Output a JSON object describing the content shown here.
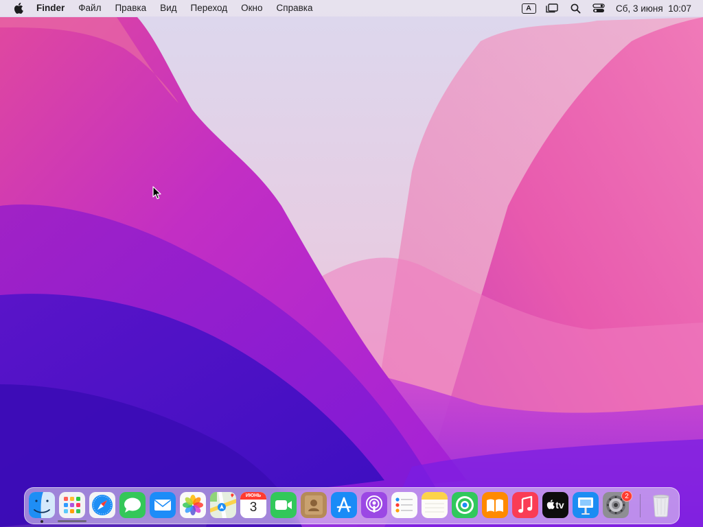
{
  "menubar": {
    "app_name": "Finder",
    "menus": [
      "Файл",
      "Правка",
      "Вид",
      "Переход",
      "Окно",
      "Справка"
    ],
    "input_source": "A",
    "date": "Сб, 3 июня",
    "time": "10:07",
    "icons": [
      "apple-icon",
      "input-source-icon",
      "stage-manager-icon",
      "spotlight-icon",
      "control-center-icon"
    ]
  },
  "dock": {
    "apps": [
      {
        "name": "finder",
        "icon": "finder-icon",
        "running": true
      },
      {
        "name": "launchpad",
        "icon": "launchpad-icon"
      },
      {
        "name": "safari",
        "icon": "safari-icon"
      },
      {
        "name": "messages",
        "icon": "messages-icon"
      },
      {
        "name": "mail",
        "icon": "mail-icon"
      },
      {
        "name": "photos",
        "icon": "photos-icon"
      },
      {
        "name": "maps",
        "icon": "maps-icon"
      },
      {
        "name": "calendar",
        "icon": "calendar-icon"
      },
      {
        "name": "facetime",
        "icon": "facetime-icon"
      },
      {
        "name": "contacts",
        "icon": "contacts-icon"
      },
      {
        "name": "app-store",
        "icon": "app-store-icon"
      },
      {
        "name": "podcasts",
        "icon": "podcasts-icon"
      },
      {
        "name": "reminders",
        "icon": "reminders-icon"
      },
      {
        "name": "notes",
        "icon": "notes-icon"
      },
      {
        "name": "find-my",
        "icon": "find-my-icon"
      },
      {
        "name": "books",
        "icon": "books-icon"
      },
      {
        "name": "music",
        "icon": "music-icon"
      },
      {
        "name": "apple-tv",
        "icon": "apple-tv-icon"
      },
      {
        "name": "keynote",
        "icon": "keynote-icon"
      },
      {
        "name": "system-settings",
        "icon": "gear-icon"
      },
      {
        "name": "trash",
        "icon": "trash-icon"
      }
    ],
    "calendar": {
      "month": "ИЮНЬ",
      "day": "3"
    },
    "settings_badge": "2",
    "tv_label": "tv"
  },
  "colors": {
    "accent_red": "#ff3b30",
    "wallpaper_deep_purple": "#4a10c8",
    "wallpaper_magenta": "#d83aa8",
    "wallpaper_pink": "#f0b3cf"
  }
}
